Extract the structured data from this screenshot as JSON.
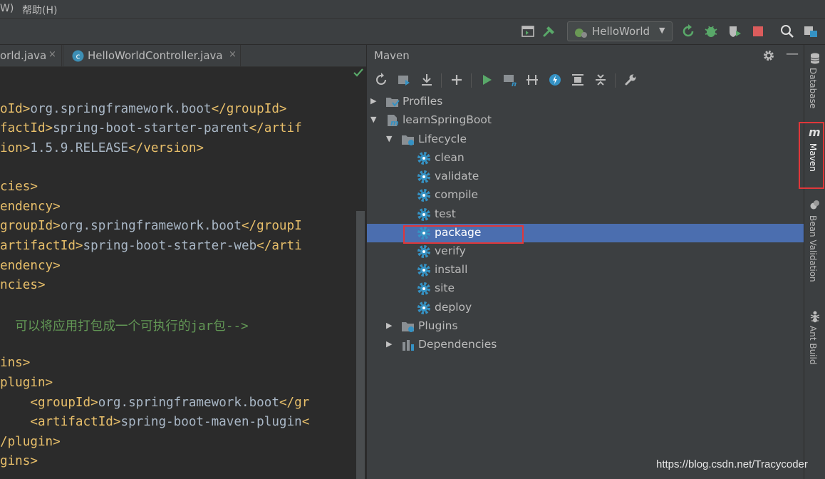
{
  "menubar": {
    "items": [
      "W)",
      "帮助(H)"
    ]
  },
  "toolbar": {
    "run_config": "HelloWorld"
  },
  "editor": {
    "tabs": [
      {
        "label": "orld.java",
        "close": "×"
      },
      {
        "label": "HelloWorldController.java",
        "close": "×",
        "badge": "c"
      }
    ],
    "lines": [
      {
        "seg": [
          [
            "tag",
            "oId>"
          ],
          [
            "txt",
            "org.springframework.boot"
          ],
          [
            "tag",
            "</groupId>"
          ]
        ]
      },
      {
        "seg": [
          [
            "tag",
            "factId>"
          ],
          [
            "txt",
            "spring-boot-starter-parent"
          ],
          [
            "tag",
            "</artif"
          ]
        ]
      },
      {
        "seg": [
          [
            "tag",
            "ion>"
          ],
          [
            "txt",
            "1.5.9.RELEASE"
          ],
          [
            "tag",
            "</version>"
          ]
        ]
      },
      {
        "seg": [
          [
            "tag",
            "cies>"
          ]
        ]
      },
      {
        "seg": [
          [
            "tag",
            "endency>"
          ]
        ]
      },
      {
        "seg": [
          [
            "tag",
            "groupId>"
          ],
          [
            "txt",
            "org.springframework.boot"
          ],
          [
            "tag",
            "</groupI"
          ]
        ]
      },
      {
        "seg": [
          [
            "tag",
            "artifactId>"
          ],
          [
            "txt",
            "spring-boot-starter-web"
          ],
          [
            "tag",
            "</arti"
          ]
        ]
      },
      {
        "seg": [
          [
            "tag",
            "endency>"
          ]
        ]
      },
      {
        "seg": [
          [
            "tag",
            "ncies>"
          ]
        ]
      },
      {
        "seg": [
          [
            "cmt",
            "  可以将应用打包成一个可执行的jar包-->"
          ]
        ]
      },
      {
        "seg": [
          [
            "tag",
            "ins>"
          ]
        ]
      },
      {
        "seg": [
          [
            "tag",
            "plugin>"
          ]
        ]
      },
      {
        "seg": [
          [
            "txt",
            "    "
          ],
          [
            "tag",
            "<groupId>"
          ],
          [
            "txt",
            "org.springframework.boot"
          ],
          [
            "tag",
            "</gr"
          ]
        ]
      },
      {
        "seg": [
          [
            "txt",
            "    "
          ],
          [
            "tag",
            "<artifactId>"
          ],
          [
            "txt",
            "spring-boot-maven-plugin"
          ],
          [
            "tag",
            "<"
          ]
        ]
      },
      {
        "seg": [
          [
            "tag",
            "/plugin>"
          ]
        ]
      },
      {
        "seg": [
          [
            "tag",
            "gins>"
          ]
        ]
      }
    ]
  },
  "maven": {
    "title": "Maven",
    "tree": [
      {
        "label": "Profiles",
        "arrow": "▶",
        "icon": "folder-profiles-icon"
      },
      {
        "label": "learnSpringBoot",
        "arrow": "▼",
        "icon": "maven-project-icon"
      },
      {
        "label": "Lifecycle",
        "arrow": "▼",
        "icon": "folder-lifecycle-icon"
      },
      {
        "label": "clean",
        "icon": "gear-icon"
      },
      {
        "label": "validate",
        "icon": "gear-icon"
      },
      {
        "label": "compile",
        "icon": "gear-icon"
      },
      {
        "label": "test",
        "icon": "gear-icon"
      },
      {
        "label": "package",
        "icon": "gear-icon",
        "selected": true
      },
      {
        "label": "verify",
        "icon": "gear-icon"
      },
      {
        "label": "install",
        "icon": "gear-icon"
      },
      {
        "label": "site",
        "icon": "gear-icon"
      },
      {
        "label": "deploy",
        "icon": "gear-icon"
      },
      {
        "label": "Plugins",
        "arrow": "▶",
        "icon": "folder-plugins-icon"
      },
      {
        "label": "Dependencies",
        "arrow": "▶",
        "icon": "dependencies-icon"
      }
    ]
  },
  "rightstrip": {
    "database": "Database",
    "maven_m": "m",
    "maven": "Maven",
    "bean_validation": "Bean Validation",
    "ant_build": "Ant Build"
  },
  "watermark": "https://blog.csdn.net/Tracycoder",
  "colors": {
    "selection": "#4b6eaf",
    "highlight_box": "#e0373a",
    "gear": "#3592c4",
    "tag": "#e8bf6a",
    "comment": "#629755"
  }
}
